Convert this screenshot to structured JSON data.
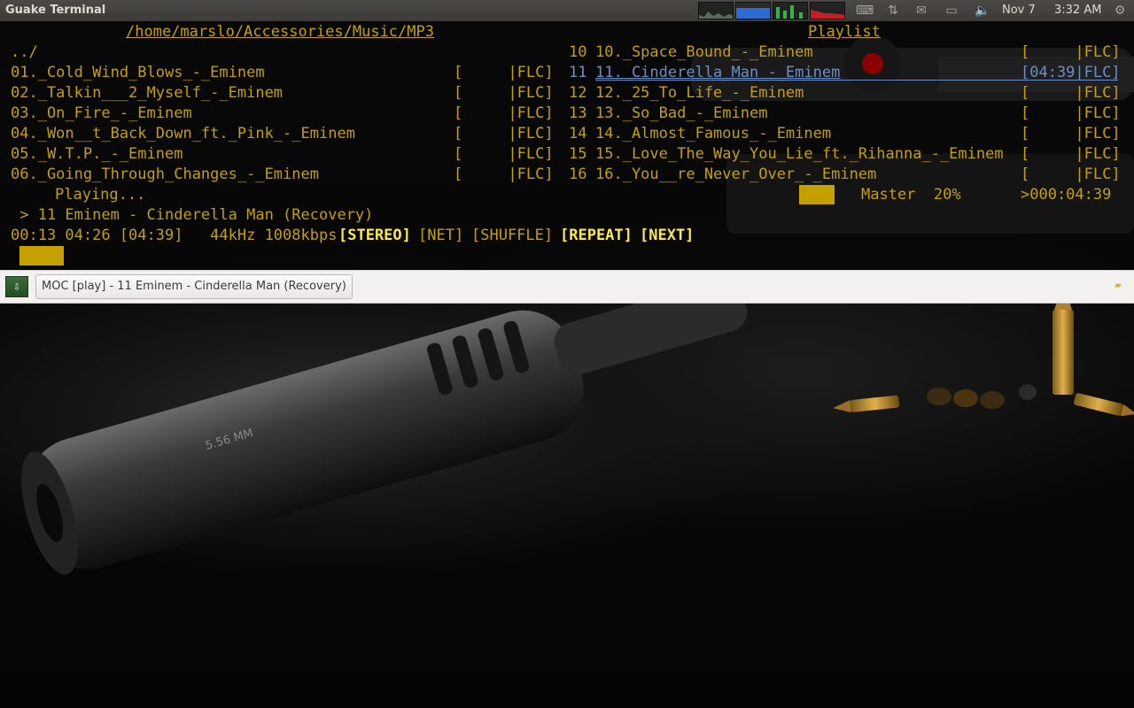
{
  "panel": {
    "app_title": "Guake Terminal",
    "date": "Nov 7",
    "time": "3:32 AM",
    "tray_icons": [
      "keyboard-icon",
      "network-transfer-icon",
      "mail-icon",
      "battery-icon",
      "volume-icon",
      "gear-icon"
    ]
  },
  "terminal": {
    "left_header": "/home/marslo/Accessories/Music/MP3",
    "right_header": "Playlist",
    "parent_dir": "../",
    "files": [
      {
        "name": "01._Cold_Wind_Blows_-_Eminem",
        "time": "[     |FLC]"
      },
      {
        "name": "02._Talkin___2_Myself_-_Eminem",
        "time": "[     |FLC]"
      },
      {
        "name": "03._On_Fire_-_Eminem",
        "time": "[     |FLC]"
      },
      {
        "name": "04._Won__t_Back_Down_ft._Pink_-_Eminem",
        "time": "[     |FLC]"
      },
      {
        "name": "05._W.T.P._-_Eminem",
        "time": "[     |FLC]"
      },
      {
        "name": "06._Going_Through_Changes_-_Eminem",
        "time": "[     |FLC]"
      }
    ],
    "playlist": [
      {
        "num": "10",
        "name": "10._Space_Bound_-_Eminem",
        "time": "[     |FLC]"
      },
      {
        "num": "11",
        "name": "11._Cinderella_Man_-_Eminem",
        "time": "[04:39|FLC]"
      },
      {
        "num": "12",
        "name": "12._25_To_Life_-_Eminem",
        "time": "[     |FLC]"
      },
      {
        "num": "13",
        "name": "13._So_Bad_-_Eminem",
        "time": "[     |FLC]"
      },
      {
        "num": "14",
        "name": "14._Almost_Famous_-_Eminem",
        "time": "[     |FLC]"
      },
      {
        "num": "15",
        "name": "15._Love_The_Way_You_Lie_ft._Rihanna_-_Eminem",
        "time": "[     |FLC]"
      },
      {
        "num": "16",
        "name": "16._You__re_Never_Over_-_Eminem",
        "time": "[     |FLC]"
      }
    ],
    "status": "Playing...",
    "mixer_label": "Master  20%",
    "volume_percent": 20,
    "total_time": ">000:04:39",
    "now_playing": " > 11 Eminem - Cinderella Man (Recovery)",
    "time_info": "00:13 04:26 [04:39]   44kHz 1008kbps",
    "flags": {
      "stereo": "[STEREO]",
      "net": "[NET]",
      "shuffle": "[SHUFFLE]",
      "repeat": "[REPEAT]",
      "next": "[NEXT]"
    }
  },
  "tabbar": {
    "tab_label": "MOC [play] - 11 Eminem - Cinderella Man (Recovery)"
  },
  "colors": {
    "terminal_fg": "#c4a000",
    "terminal_bright": "#fce94f",
    "selection": "#6b8fc4",
    "panel_bg": "#3c3b37",
    "tabbar_bg": "#f2f1f0"
  }
}
